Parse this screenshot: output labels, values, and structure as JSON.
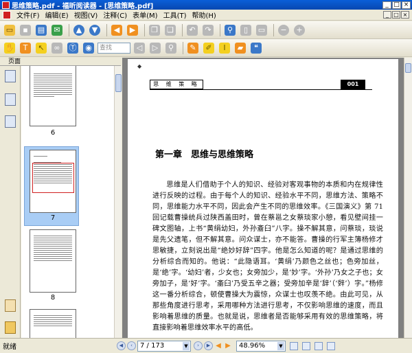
{
  "window": {
    "title": "思维策略.pdf - 福昕阅读器 - [思维策略.pdf]",
    "minimize_label": "_",
    "maximize_label": "□",
    "close_label": "×"
  },
  "menubar": {
    "items": [
      "文件(F)",
      "编辑(E)",
      "视图(V)",
      "注释(C)",
      "表单(M)",
      "工具(T)",
      "帮助(H)"
    ]
  },
  "toolbar2": {
    "search_placeholder": "查找"
  },
  "sidebar": {
    "header": "页面",
    "thumbnails": [
      {
        "label": "6"
      },
      {
        "label": "7"
      },
      {
        "label": "8"
      }
    ]
  },
  "document": {
    "running_header": "思 维 策 略",
    "page_number": "001",
    "chapter_title": "第一章　思维与思维策略",
    "paragraph": "思维是人们借助于个人的知识、经验对客观事物的本质和内在规律性进行反映的过程。由于每个人的知识、经验水平不同，思维方法、策略不同，思维能力水平不同，因此会产生不同的思维效率。《三国演义》第 71 回记载曹操统兵过陕西盖田时，曾在蔡邕之女蔡琰家小憩，看见壁间挂一碑文图轴，上书“黄绢幼妇，外孙齑臼”八字。操不解其意，问蔡琰，琰说是先父遗笔，但不解其意。问众谋士，亦不能答。曹操的行军主簿杨修才思敏捷，立刻说出是“绝妙好辞”四字。他是怎么知道的呢？是通过思维的分析综合而知的。他说：“此隐语耳。‘黄绢’乃颜色之丝也；色旁加丝，是‘绝’字。‘幼妇’者，少女也；女旁加少，是‘妙’字。‘外孙’乃女之子也；女旁加子，是‘好’字。‘齑臼’乃受五辛之器；受旁加辛是‘辞’（‘辤’）字。”杨修这一番分析综合，顿使曹操大为震惊，众谋士也叹羡不绝。由此可见，从那些角度进行思考，采用哪种方法进行思考，不仅影响思维的速度，而且影响着思维的质量。也就是说，思维者是否能够采用有效的思维策略，将直接影响着思维效率水平的高低。"
  },
  "statusbar": {
    "status": "就绪",
    "page_indicator": "7 / 173",
    "zoom": "48.96%"
  },
  "icons": {
    "accent_blue": "#0a5fd8",
    "selection_blue": "#a9cdf5"
  }
}
